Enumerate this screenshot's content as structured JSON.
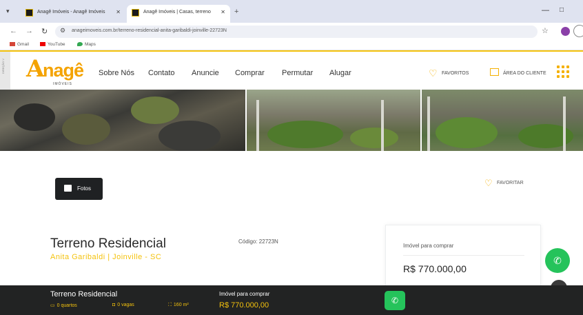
{
  "browser": {
    "tabs": [
      {
        "title": "Anagê Imóveis - Anagê Imóveis"
      },
      {
        "title": "Anagê Imóveis | Casas, terreno"
      }
    ],
    "url": "anageimoveis.com.br/terreno-residencial-anita-garibaldi-joinville-22723N",
    "bookmarks": [
      "Gmail",
      "YouTube",
      "Maps"
    ]
  },
  "site": {
    "logo_first": "A",
    "logo_rest": "nagê",
    "logo_tagline": "IMÓVEIS",
    "side_strip": "DIREÇÃO V",
    "nav": [
      "Sobre Nós",
      "Contato",
      "Anuncie",
      "Comprar",
      "Permutar",
      "Alugar"
    ],
    "favorites_label": "FAVORITOS",
    "client_area_label": "ÁREA DO CLIENTE",
    "accent_color": "#f4c20d"
  },
  "gallery": {
    "photos_button": "Fotos",
    "favorite_label": "FAVORITAR"
  },
  "property": {
    "title": "Terreno Residencial",
    "location": "Anita Garibaldi | Joinville - SC",
    "code": "Código: 22723N",
    "card_label": "Imóvel para comprar",
    "price": "R$ 770.000,00"
  },
  "bottom_bar": {
    "title": "Terreno Residencial",
    "bedrooms": "0 quartos",
    "parking": "0 vagas",
    "area": "160 m²",
    "buy_label": "Imóvel para comprar",
    "price": "R$ 770.000,00"
  }
}
